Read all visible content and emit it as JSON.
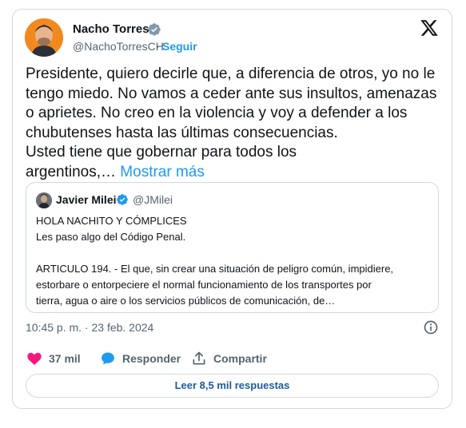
{
  "author": {
    "name": "Nacho Torres",
    "handle": "@NachoTorresCH",
    "separator": "·",
    "follow_label": "Seguir"
  },
  "tweet": {
    "text": "Presidente, quiero decirle que, a diferencia de otros, yo no le\ntengo miedo. No vamos a ceder ante sus insultos, amenazas\no aprietes. No creo en la violencia y voy a defender a los\nchubutenses hasta las últimas consecuencias.\nUsted tiene que gobernar para todos los\nargentinos,… ",
    "show_more_label": "Mostrar más"
  },
  "quote": {
    "name": "Javier Milei",
    "handle": "@JMilei",
    "text": "HOLA NACHITO Y CÓMPLICES\nLes paso algo del Código Penal.\n\nARTICULO 194. - El que, sin crear una situación de peligro común, impidiere,\nestorbare o entorpeciere el normal funcionamiento de los transportes por\ntierra, agua o aire o los servicios públicos de comunicación, de…"
  },
  "meta": {
    "timestamp": "10:45 p. m. · 23 feb. 2024"
  },
  "actions": {
    "like_count": "37 mil",
    "reply_label": "Responder",
    "share_label": "Compartir"
  },
  "read_replies_label": "Leer 8,5 mil respuestas",
  "icons": {
    "verified": "verified-badge-icon",
    "x_logo": "x-logo-icon",
    "info": "info-icon",
    "like": "heart-icon",
    "reply": "speech-bubble-icon",
    "share": "share-upload-icon"
  },
  "colors": {
    "accent": "#1d9bf0",
    "like": "#f91880",
    "secondary_text": "#536471",
    "border": "#cfd9de",
    "replies_text": "#1d5a9b"
  }
}
